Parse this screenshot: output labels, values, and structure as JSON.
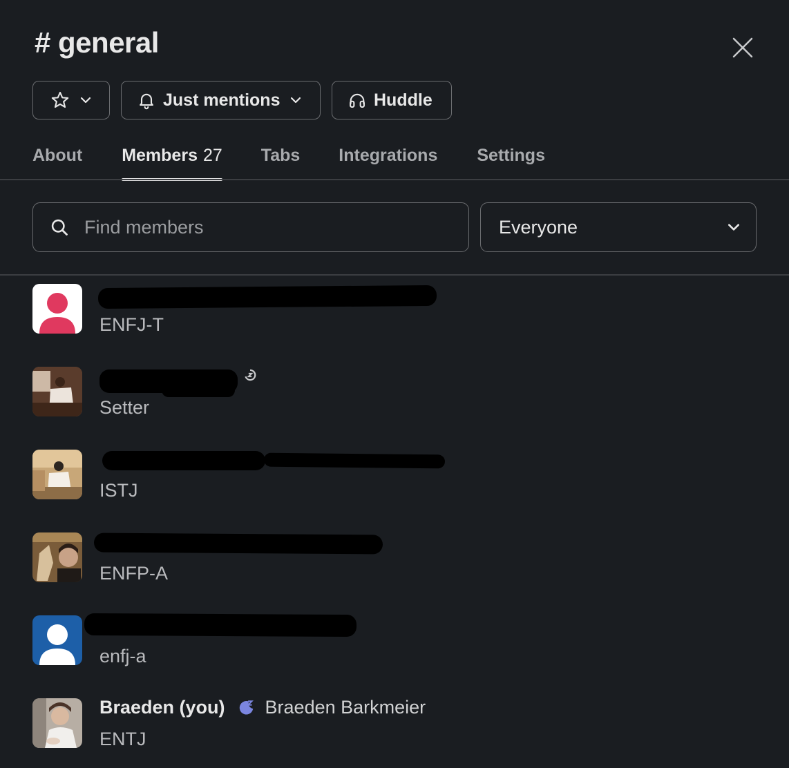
{
  "header": {
    "title": "# general"
  },
  "actions": {
    "notify_label": "Just mentions",
    "huddle_label": "Huddle"
  },
  "tabs": [
    {
      "label": "About"
    },
    {
      "label": "Members",
      "count": "27"
    },
    {
      "label": "Tabs"
    },
    {
      "label": "Integrations"
    },
    {
      "label": "Settings"
    }
  ],
  "search": {
    "placeholder": "Find members"
  },
  "filter": {
    "selected": "Everyone"
  },
  "members": [
    {
      "subtitle": "ENFJ-T",
      "status": "away-icon"
    },
    {
      "subtitle": "Setter",
      "status": "away-icon"
    },
    {
      "subtitle": "ISTJ",
      "status": "away-icon"
    },
    {
      "subtitle": "ENFP-A",
      "status": "away-icon"
    },
    {
      "subtitle": "enfj-a"
    },
    {
      "display_name": "Braeden (you)",
      "full_name": "Braeden Barkmeier",
      "subtitle": "ENTJ",
      "status": "snooze-icon"
    }
  ],
  "colors": {
    "background": "#1a1d21",
    "avatar_red": "#e8365d",
    "avatar_blue": "#1d5fa8",
    "snooze_purple": "#7b86e0"
  }
}
